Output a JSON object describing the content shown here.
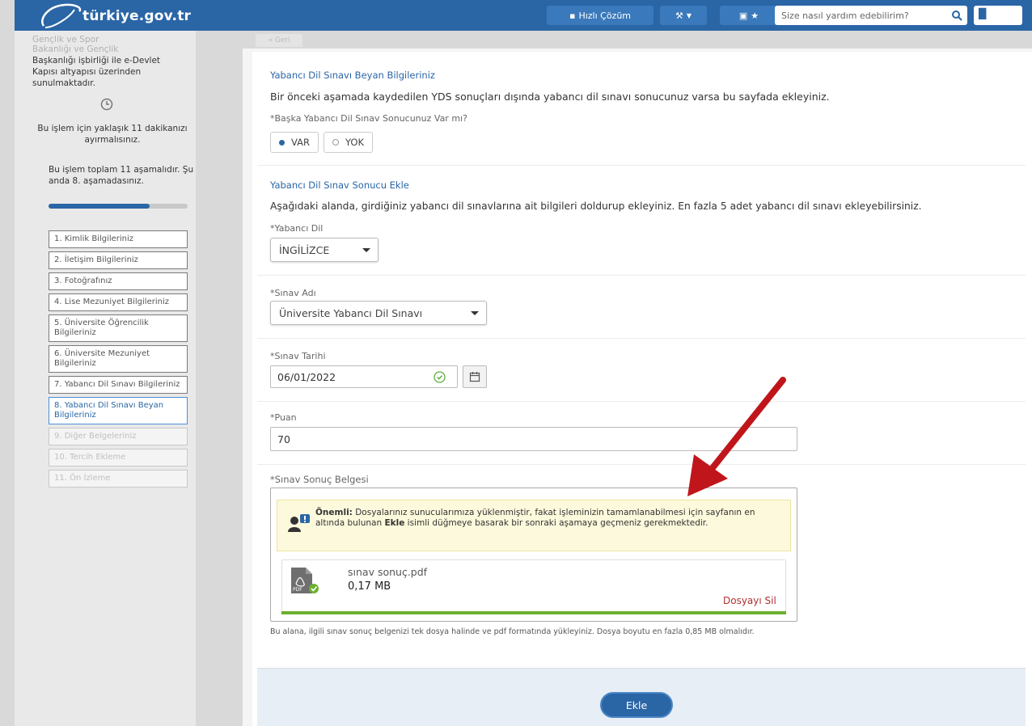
{
  "header": {
    "logo_text": "türkiye.gov.tr",
    "quick_solution_label": "Hızlı Çözüm",
    "search_placeholder": "Size nasıl yardım edebilirim?"
  },
  "subbar": {
    "back_label": "« Geri"
  },
  "sidebar": {
    "intro_faded": "Gençlik ve Spor",
    "intro_line_faded2": "Bakanlığı ve Gençlik",
    "intro": "Başkanlığı işbirliği ile e-Devlet Kapısı altyapısı üzerinden sunulmaktadır.",
    "time_text": "Bu işlem için yaklaşık 11 dakikanızı ayırmalısınız.",
    "steps_info": "Bu işlem toplam 11 aşamalıdır. Şu anda 8. aşamadasınız.",
    "progress": 0.727,
    "steps": [
      "1. Kimlik Bilgileriniz",
      "2. İletişim Bilgileriniz",
      "3. Fotoğrafınız",
      "4. Lise Mezuniyet Bilgileriniz",
      "5. Üniversite Öğrencilik Bilgileriniz",
      "6. Üniversite Mezuniyet Bilgileriniz",
      "7. Yabancı Dil Sınavı Bilgileriniz",
      "8. Yabancı Dil Sınavı Beyan Bilgileriniz",
      "9. Diğer Belgeleriniz",
      "10. Tercih Ekleme",
      "11. Ön İzleme"
    ]
  },
  "form": {
    "section1_title": "Yabancı Dil Sınavı Beyan Bilgileriniz",
    "section1_desc": "Bir önceki aşamada kaydedilen YDS sonuçları dışında yabancı dil sınavı sonucunuz varsa bu sayfada ekleyiniz.",
    "question_label": "*Başka Yabancı Dil Sınav Sonucunuz Var mı?",
    "radio_yes": "VAR",
    "radio_no": "YOK",
    "section2_title": "Yabancı Dil Sınav Sonucu Ekle",
    "section2_desc": "Aşağıdaki alanda, girdiğiniz yabancı dil sınavlarına ait bilgileri doldurup ekleyiniz. En fazla 5 adet yabancı dil sınavı ekleyebilirsiniz.",
    "language_label": "*Yabancı Dil",
    "language_value": "İNGİLİZCE",
    "exam_label": "*Sınav Adı",
    "exam_value": "Üniversite Yabancı Dil Sınavı",
    "date_label": "*Sınav Tarihi",
    "date_value": "06/01/2022",
    "score_label": "*Puan",
    "score_value": "70",
    "doc_label": "*Sınav Sonuç Belgesi",
    "warning_bold": "Önemli:",
    "warning_text": " Dosyalarınız sunucularımıza yüklenmiştir, fakat işleminizin tamamlanabilmesi için sayfanın en altında bulunan ",
    "warning_bold2": "Ekle",
    "warning_text2": " isimli düğmeye basarak bir sonraki aşamaya geçmeniz gerekmektedir.",
    "file_name": "sınav sonuç.pdf",
    "file_size": "0,17 MB",
    "file_icon_label": "PDF",
    "file_delete": "Dosyayı Sil",
    "upload_progress": 1.0,
    "help_text": "Bu alana, ilgili sınav sonuç belgenizi tek dosya halinde ve pdf formatında yükleyiniz. Dosya boyutu en fazla 0,85 MB olmalıdır.",
    "submit_label": "Ekle"
  },
  "colors": {
    "brand": "#2a66a6",
    "success": "#6cb12e",
    "warning_bg": "#fdf9dc",
    "annotation_arrow": "#c0161b"
  }
}
